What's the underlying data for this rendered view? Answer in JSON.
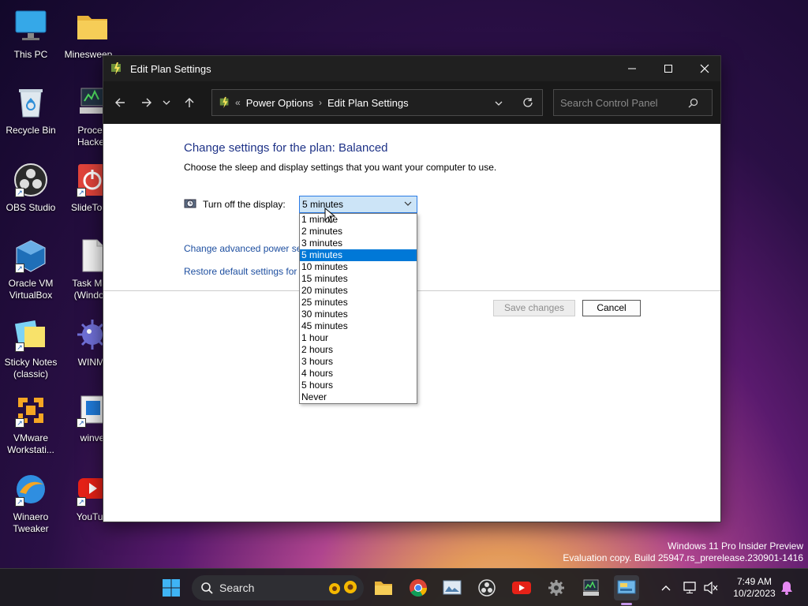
{
  "desktop": {
    "icons": [
      {
        "label": "This PC",
        "icon": "monitor-icon"
      },
      {
        "label": "Minesweep...",
        "icon": "folder-icon"
      },
      {
        "label": "Recycle Bin",
        "icon": "recycle-bin-icon"
      },
      {
        "label": "Proces\nHacker",
        "icon": "process-hacker-icon"
      },
      {
        "label": "OBS Studio",
        "icon": "obs-icon"
      },
      {
        "label": "SlideToSh",
        "icon": "power-icon"
      },
      {
        "label": "Oracle VM\nVirtualBox",
        "icon": "virtualbox-icon"
      },
      {
        "label": "Task Man\n(Window",
        "icon": "document-icon"
      },
      {
        "label": "Sticky Notes\n(classic)",
        "icon": "sticky-notes-icon"
      },
      {
        "label": "WINMI",
        "icon": "mine-icon"
      },
      {
        "label": "VMware\nWorkstati...",
        "icon": "vmware-icon"
      },
      {
        "label": "winve",
        "icon": "winver-icon"
      },
      {
        "label": "Winaero\nTweaker",
        "icon": "winaero-icon"
      },
      {
        "label": "YouTub",
        "icon": "youtube-icon"
      }
    ]
  },
  "window": {
    "title": "Edit Plan Settings",
    "breadcrumb": {
      "overflow": "«",
      "items": [
        "Power Options",
        "Edit Plan Settings"
      ]
    },
    "search_placeholder": "Search Control Panel",
    "heading": "Change settings for the plan: Balanced",
    "subtext": "Choose the sleep and display settings that you want your computer to use.",
    "display_label": "Turn off the display:",
    "display_value": "5 minutes",
    "options": [
      "1 minute",
      "2 minutes",
      "3 minutes",
      "5 minutes",
      "10 minutes",
      "15 minutes",
      "20 minutes",
      "25 minutes",
      "30 minutes",
      "45 minutes",
      "1 hour",
      "2 hours",
      "3 hours",
      "4 hours",
      "5 hours",
      "Never"
    ],
    "selected_index": 3,
    "advanced_link": "Change advanced power se",
    "restore_link": "Restore default settings for t",
    "save_label": "Save changes",
    "cancel_label": "Cancel"
  },
  "watermark": {
    "line1": "Windows 11 Pro Insider Preview",
    "line2": "Evaluation copy. Build 25947.rs_prerelease.230901-1416"
  },
  "taskbar": {
    "search_label": "Search",
    "time": "7:49 AM",
    "date": "10/2/2023"
  },
  "colors": {
    "heading": "#1e3287",
    "link": "#1e4fa0",
    "selection": "#0078d7",
    "accent": "#c495e8"
  }
}
